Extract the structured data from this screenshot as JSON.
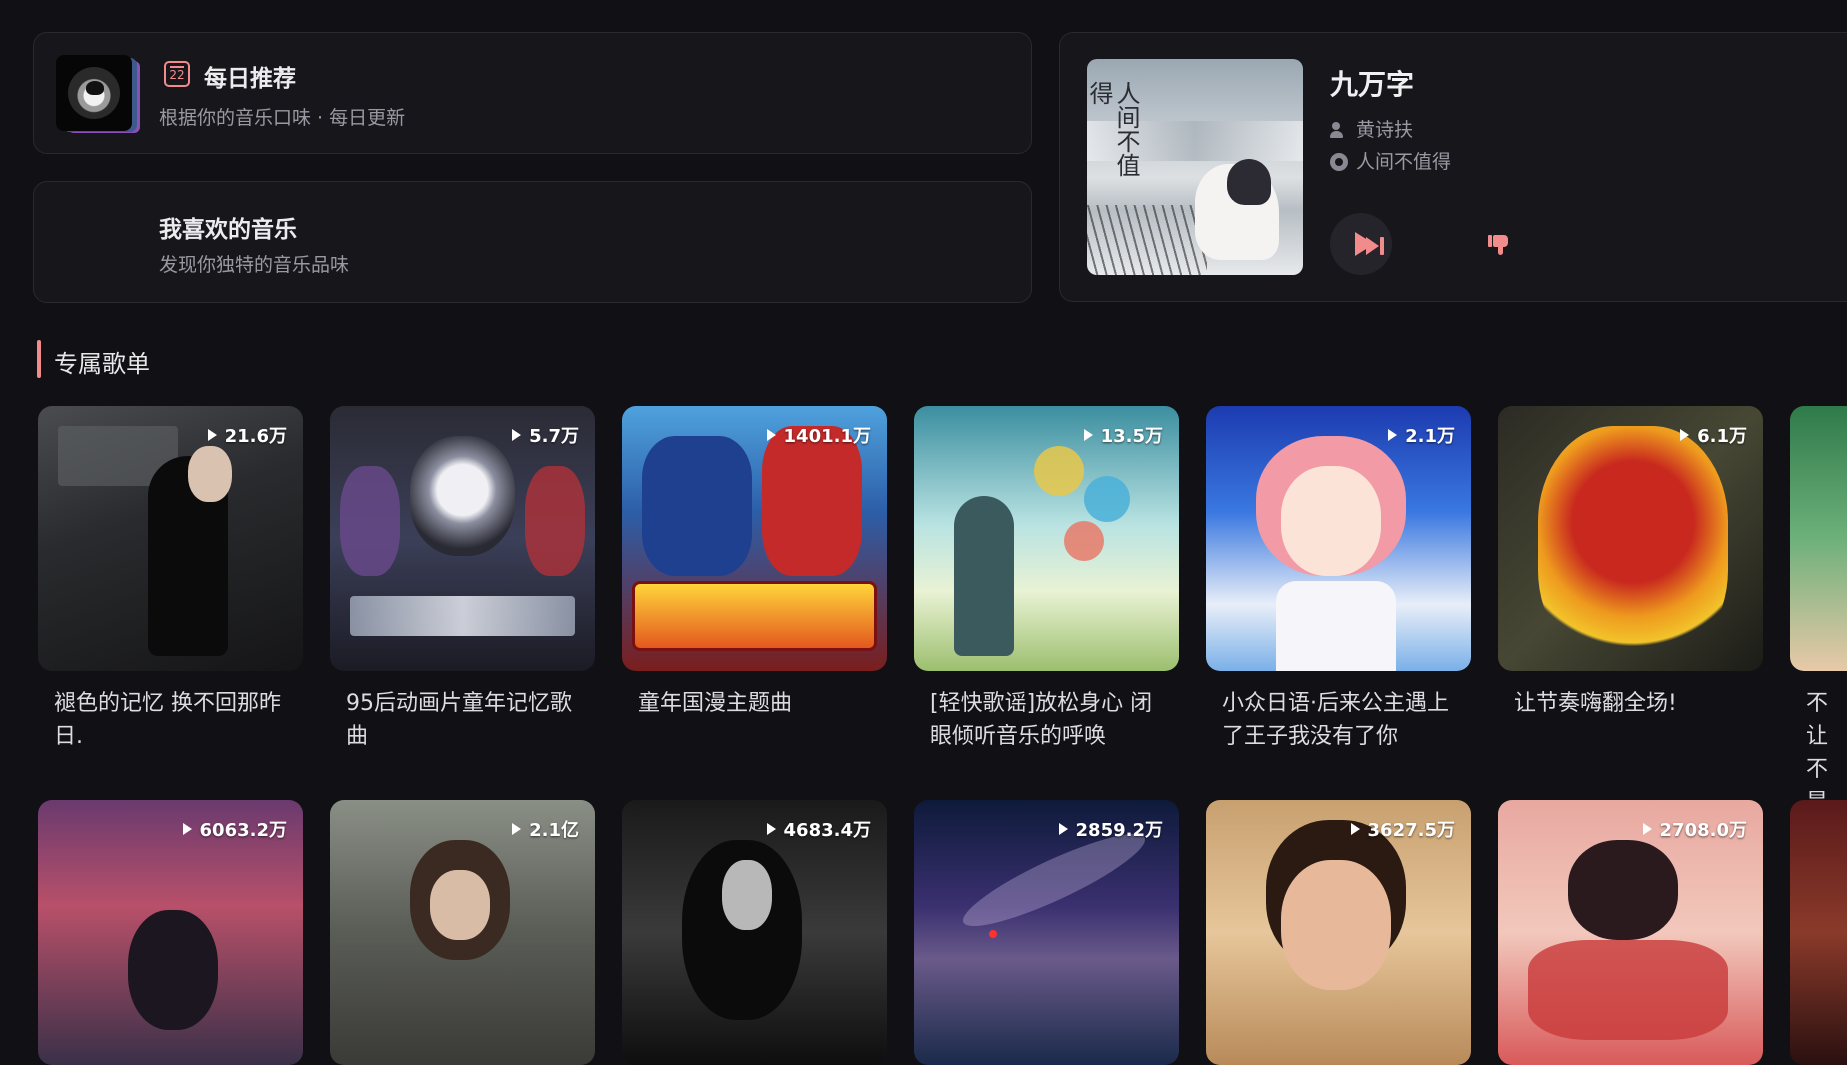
{
  "daily": {
    "title": "每日推荐",
    "subtitle": "根据你的音乐口味 · 每日更新",
    "calendar_day": "22",
    "icon": "calendar-icon"
  },
  "liked": {
    "title": "我喜欢的音乐",
    "subtitle": "发现你独特的音乐品味"
  },
  "player": {
    "song": "九万字",
    "artist": "黄诗扶",
    "album": "人间不值得",
    "cover_text": "人间不值得",
    "accent": "#f28b8b"
  },
  "section": {
    "title": "专属歌单"
  },
  "playlists": [
    {
      "title": "褪色的记忆 换不回那昨日.",
      "count": "21.6万"
    },
    {
      "title": "95后动画片童年记忆歌曲",
      "count": "5.7万"
    },
    {
      "title": "童年国漫主题曲",
      "count": "1401.1万"
    },
    {
      "title": "[轻快歌谣]放松身心 闭眼倾听音乐的呼唤",
      "count": "13.5万"
    },
    {
      "title": "小众日语·后来公主遇上了王子我没有了你",
      "count": "2.1万"
    },
    {
      "title": "让节奏嗨翻全场!",
      "count": "6.1万"
    },
    {
      "title": "不让 不是",
      "count": ""
    }
  ],
  "playlists_row2": [
    {
      "title": "",
      "count": "6063.2万"
    },
    {
      "title": "",
      "count": "2.1亿"
    },
    {
      "title": "",
      "count": "4683.4万"
    },
    {
      "title": "",
      "count": "2859.2万"
    },
    {
      "title": "",
      "count": "3627.5万"
    },
    {
      "title": "",
      "count": "2708.0万"
    },
    {
      "title": "",
      "count": ""
    }
  ]
}
